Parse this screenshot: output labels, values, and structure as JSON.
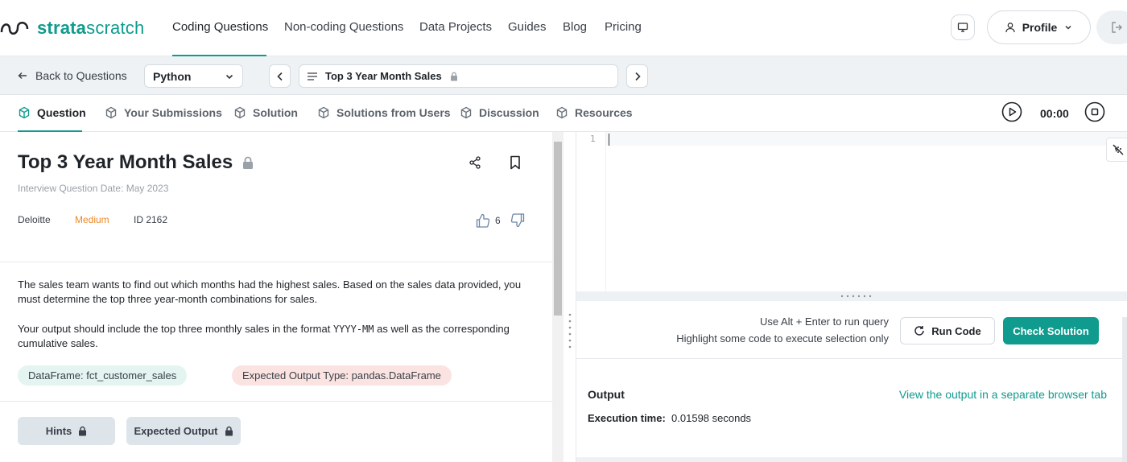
{
  "brand": {
    "part1": "strata",
    "part2": "scratch"
  },
  "nav": {
    "links": [
      "Coding Questions",
      "Non-coding Questions",
      "Data Projects",
      "Guides",
      "Blog",
      "Pricing"
    ],
    "profile_label": "Profile"
  },
  "subbar": {
    "back_label": "Back to Questions",
    "language": "Python",
    "question_title": "Top 3 Year Month Sales"
  },
  "tabs": {
    "items": [
      "Question",
      "Your Submissions",
      "Solution",
      "Solutions from Users",
      "Discussion",
      "Resources"
    ],
    "timer": "00:00"
  },
  "question": {
    "title": "Top 3 Year Month Sales",
    "date": "Interview Question Date: May 2023",
    "company": "Deloitte",
    "difficulty": "Medium",
    "id": "ID 2162",
    "likes": "6",
    "desc1": "The sales team wants to find out which months had the highest sales. Based on the sales data provided, you must determine the top three year-month combinations for sales.",
    "desc2_pre": "Your output should include the top three monthly sales in the format ",
    "desc2_code": "YYYY-MM",
    "desc2_post": " as well as the corresponding cumulative sales.",
    "dataframe": "DataFrame: fct_customer_sales",
    "expected_type": "Expected Output Type: pandas.DataFrame",
    "hints_label": "Hints",
    "expected_label": "Expected Output"
  },
  "editor": {
    "line_number": "1"
  },
  "run": {
    "hint1": "Use Alt + Enter to run query",
    "hint2": "Highlight some code to execute selection only",
    "run_label": "Run Code",
    "check_label": "Check Solution"
  },
  "output": {
    "title": "Output",
    "link": "View the output in a separate browser tab",
    "exec_label": "Execution time:",
    "exec_value": "0.01598 seconds"
  },
  "colors": {
    "accent": "#0f9b8e",
    "medium": "#e9892b",
    "pill_green": "#e3f4f1",
    "pill_red": "#fbe3e1"
  }
}
